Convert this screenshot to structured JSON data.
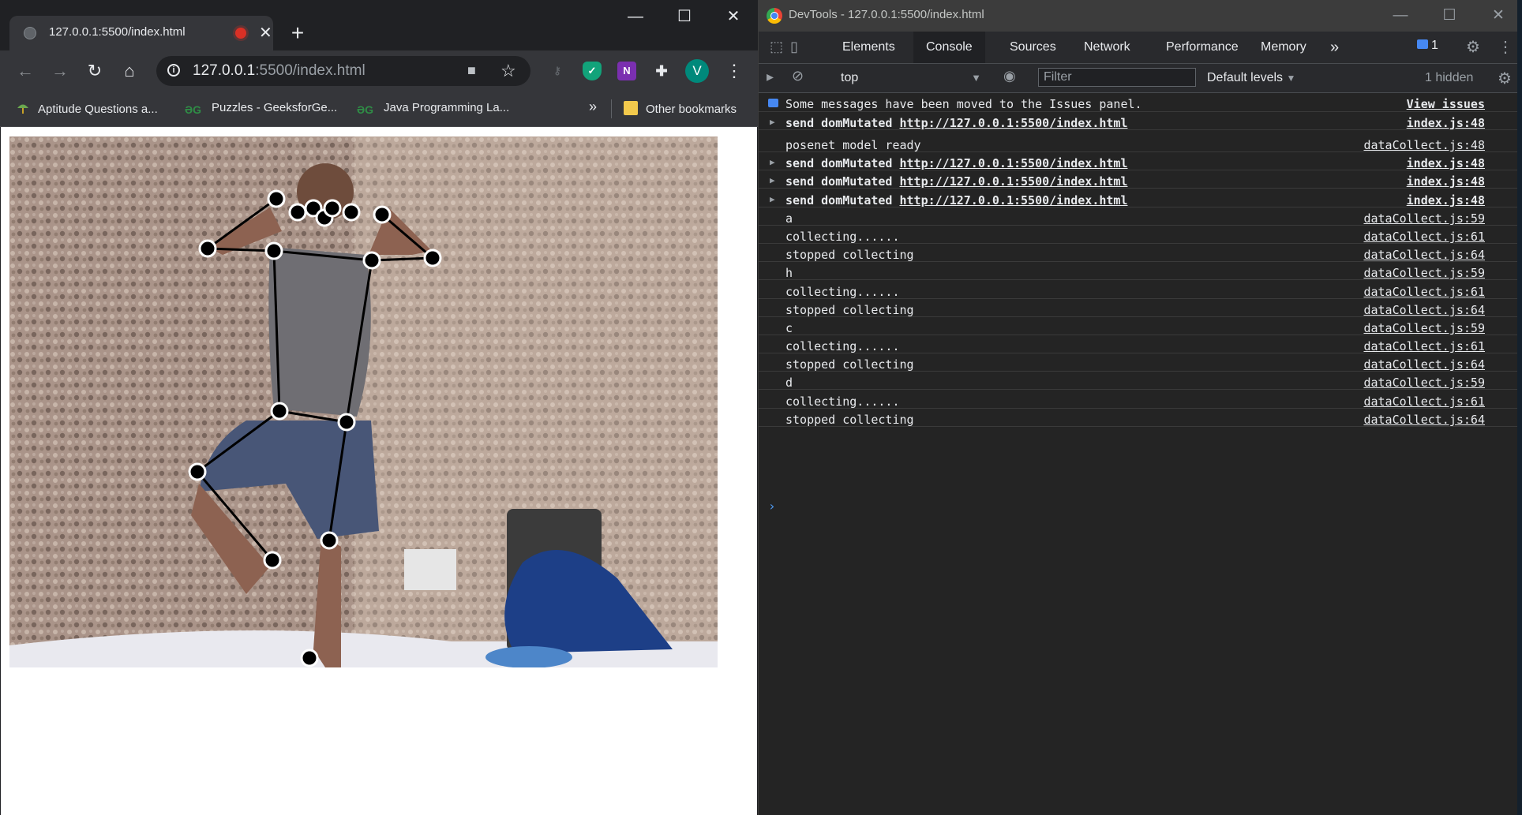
{
  "browser": {
    "tab_title": "127.0.0.1:5500/index.html",
    "new_tab": "+",
    "address": {
      "host": "127.0.0.1",
      "rest": ":5500/index.html"
    },
    "window_controls": [
      "—",
      "☐",
      "✕"
    ],
    "bookmarks": [
      {
        "label": "Aptitude Questions a...",
        "icon": "umbrella-icon"
      },
      {
        "label": "Puzzles - GeeksforGe...",
        "icon": "gfg-icon"
      },
      {
        "label": "Java Programming La...",
        "icon": "gfg-icon"
      }
    ],
    "bookmarks_overflow": "»",
    "other_bookmarks": "Other bookmarks",
    "avatar_letter": "V"
  },
  "devtools": {
    "window_title": "DevTools - 127.0.0.1:5500/index.html",
    "tabs": [
      "Elements",
      "Console",
      "Sources",
      "Network",
      "Performance",
      "Memory"
    ],
    "active_tab": "Console",
    "more_tabs": "»",
    "issues_count": "1",
    "context": "top",
    "filter_placeholder": "Filter",
    "levels": "Default levels",
    "hidden": "1 hidden",
    "messages": [
      {
        "text": "Some messages have been moved to the Issues panel.",
        "source": "View issues",
        "kind": "issue"
      },
      {
        "text": "send domMutated ",
        "link": "http://127.0.0.1:5500/index.html",
        "source": "index.js:48",
        "kind": "group"
      },
      {
        "text": "posenet model ready",
        "source": "dataCollect.js:48",
        "kind": "log"
      },
      {
        "text": "send domMutated ",
        "link": "http://127.0.0.1:5500/index.html",
        "source": "index.js:48",
        "kind": "group"
      },
      {
        "text": "send domMutated ",
        "link": "http://127.0.0.1:5500/index.html",
        "source": "index.js:48",
        "kind": "group"
      },
      {
        "text": "send domMutated ",
        "link": "http://127.0.0.1:5500/index.html",
        "source": "index.js:48",
        "kind": "group"
      },
      {
        "text": "a",
        "source": "dataCollect.js:59",
        "kind": "log"
      },
      {
        "text": "collecting......",
        "source": "dataCollect.js:61",
        "kind": "log"
      },
      {
        "text": "stopped collecting",
        "source": "dataCollect.js:64",
        "kind": "log"
      },
      {
        "text": "h",
        "source": "dataCollect.js:59",
        "kind": "log"
      },
      {
        "text": "collecting......",
        "source": "dataCollect.js:61",
        "kind": "log"
      },
      {
        "text": "stopped collecting",
        "source": "dataCollect.js:64",
        "kind": "log"
      },
      {
        "text": "c",
        "source": "dataCollect.js:59",
        "kind": "log"
      },
      {
        "text": "collecting......",
        "source": "dataCollect.js:61",
        "kind": "log"
      },
      {
        "text": "stopped collecting",
        "source": "dataCollect.js:64",
        "kind": "log"
      },
      {
        "text": "d",
        "source": "dataCollect.js:59",
        "kind": "log"
      },
      {
        "text": "collecting......",
        "source": "dataCollect.js:61",
        "kind": "log"
      },
      {
        "text": "stopped collecting",
        "source": "dataCollect.js:64",
        "kind": "log"
      }
    ],
    "prompt": "›"
  },
  "colors": {
    "accent": "#4e9cf6",
    "record": "#d93025",
    "avatar": "#00897b"
  }
}
